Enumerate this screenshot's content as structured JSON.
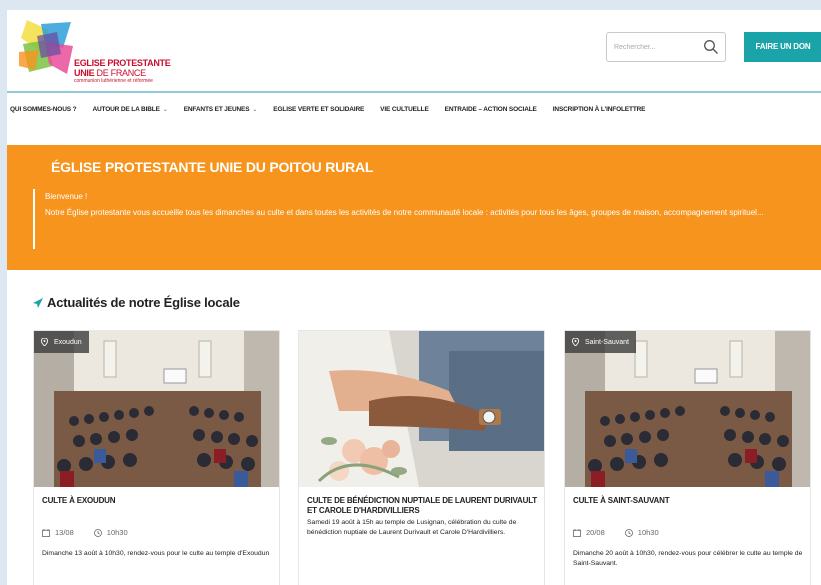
{
  "header": {
    "logo": {
      "line1": "EGLISE PROTESTANTE",
      "line2a": "UNIE",
      "line2b": "DE FRANCE",
      "line3": "communion luthérienne et réformée"
    },
    "search": {
      "placeholder": "Rechercher..."
    },
    "donate_label": "FAIRE UN DON"
  },
  "nav": {
    "items": [
      {
        "label": "QUI SOMMES-NOUS ?",
        "dropdown": false
      },
      {
        "label": "AUTOUR DE LA BIBLE",
        "dropdown": true
      },
      {
        "label": "ENFANTS ET JEUNES",
        "dropdown": true
      },
      {
        "label": "EGLISE VERTE ET SOLIDAIRE",
        "dropdown": false
      },
      {
        "label": "VIE CULTUELLE",
        "dropdown": false
      },
      {
        "label": "ENTRAIDE – ACTION SOCIALE",
        "dropdown": false
      },
      {
        "label": "INSCRIPTION À L'INFOLETTRE",
        "dropdown": false
      }
    ]
  },
  "banner": {
    "title": "ÉGLISE PROTESTANTE UNIE DU POITOU RURAL",
    "welcome": "Bienvenue !",
    "text": "Notre Église protestante vous accueille tous les dimanches au culte et dans toutes les activités de notre communauté locale : activités pour tous les âges, groupes de maison, accompagnement spirituel..."
  },
  "section": {
    "title": "Actualités de notre Église locale"
  },
  "cards": [
    {
      "tag": "Exoudun",
      "title": "CULTE À EXOUDUN",
      "date": "13/08",
      "time": "10h30",
      "desc": "Dimanche 13 août à 10h30, rendez-vous pour le culte au temple d'Exoudun"
    },
    {
      "tag": "",
      "title": "CULTE DE BÉNÉDICTION NUPTIALE DE LAURENT DURIVAULT ET CAROLE D'HARDIVILLIERS",
      "date": "",
      "time": "",
      "desc": "Samedi 19 août à 15h au temple de Lusignan, célébration du culte de bénédiction nuptiale de Laurent Durivault et Carole D'Hardivilliers."
    },
    {
      "tag": "Saint-Sauvant",
      "title": "CULTE À SAINT-SAUVANT",
      "date": "20/08",
      "time": "10h30",
      "desc": "Dimanche 20 août à 10h30, rendez-vous pour célébrer le culte au temple de Saint-Sauvant."
    }
  ],
  "colors": {
    "accent": "#1aa3a8",
    "banner": "#f7941d",
    "brand_red": "#c8102e"
  }
}
